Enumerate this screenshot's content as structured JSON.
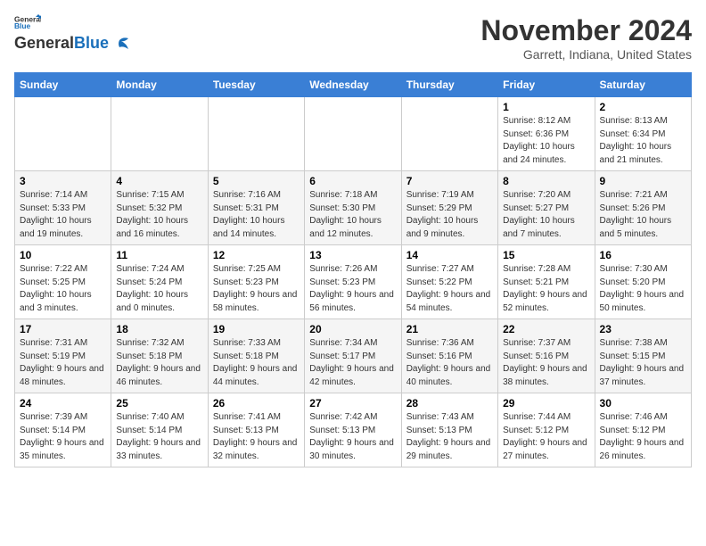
{
  "logo": {
    "general": "General",
    "blue": "Blue"
  },
  "header": {
    "title": "November 2024",
    "subtitle": "Garrett, Indiana, United States"
  },
  "weekdays": [
    "Sunday",
    "Monday",
    "Tuesday",
    "Wednesday",
    "Thursday",
    "Friday",
    "Saturday"
  ],
  "weeks": [
    [
      {
        "day": "",
        "info": ""
      },
      {
        "day": "",
        "info": ""
      },
      {
        "day": "",
        "info": ""
      },
      {
        "day": "",
        "info": ""
      },
      {
        "day": "",
        "info": ""
      },
      {
        "day": "1",
        "info": "Sunrise: 8:12 AM\nSunset: 6:36 PM\nDaylight: 10 hours and 24 minutes."
      },
      {
        "day": "2",
        "info": "Sunrise: 8:13 AM\nSunset: 6:34 PM\nDaylight: 10 hours and 21 minutes."
      }
    ],
    [
      {
        "day": "3",
        "info": "Sunrise: 7:14 AM\nSunset: 5:33 PM\nDaylight: 10 hours and 19 minutes."
      },
      {
        "day": "4",
        "info": "Sunrise: 7:15 AM\nSunset: 5:32 PM\nDaylight: 10 hours and 16 minutes."
      },
      {
        "day": "5",
        "info": "Sunrise: 7:16 AM\nSunset: 5:31 PM\nDaylight: 10 hours and 14 minutes."
      },
      {
        "day": "6",
        "info": "Sunrise: 7:18 AM\nSunset: 5:30 PM\nDaylight: 10 hours and 12 minutes."
      },
      {
        "day": "7",
        "info": "Sunrise: 7:19 AM\nSunset: 5:29 PM\nDaylight: 10 hours and 9 minutes."
      },
      {
        "day": "8",
        "info": "Sunrise: 7:20 AM\nSunset: 5:27 PM\nDaylight: 10 hours and 7 minutes."
      },
      {
        "day": "9",
        "info": "Sunrise: 7:21 AM\nSunset: 5:26 PM\nDaylight: 10 hours and 5 minutes."
      }
    ],
    [
      {
        "day": "10",
        "info": "Sunrise: 7:22 AM\nSunset: 5:25 PM\nDaylight: 10 hours and 3 minutes."
      },
      {
        "day": "11",
        "info": "Sunrise: 7:24 AM\nSunset: 5:24 PM\nDaylight: 10 hours and 0 minutes."
      },
      {
        "day": "12",
        "info": "Sunrise: 7:25 AM\nSunset: 5:23 PM\nDaylight: 9 hours and 58 minutes."
      },
      {
        "day": "13",
        "info": "Sunrise: 7:26 AM\nSunset: 5:23 PM\nDaylight: 9 hours and 56 minutes."
      },
      {
        "day": "14",
        "info": "Sunrise: 7:27 AM\nSunset: 5:22 PM\nDaylight: 9 hours and 54 minutes."
      },
      {
        "day": "15",
        "info": "Sunrise: 7:28 AM\nSunset: 5:21 PM\nDaylight: 9 hours and 52 minutes."
      },
      {
        "day": "16",
        "info": "Sunrise: 7:30 AM\nSunset: 5:20 PM\nDaylight: 9 hours and 50 minutes."
      }
    ],
    [
      {
        "day": "17",
        "info": "Sunrise: 7:31 AM\nSunset: 5:19 PM\nDaylight: 9 hours and 48 minutes."
      },
      {
        "day": "18",
        "info": "Sunrise: 7:32 AM\nSunset: 5:18 PM\nDaylight: 9 hours and 46 minutes."
      },
      {
        "day": "19",
        "info": "Sunrise: 7:33 AM\nSunset: 5:18 PM\nDaylight: 9 hours and 44 minutes."
      },
      {
        "day": "20",
        "info": "Sunrise: 7:34 AM\nSunset: 5:17 PM\nDaylight: 9 hours and 42 minutes."
      },
      {
        "day": "21",
        "info": "Sunrise: 7:36 AM\nSunset: 5:16 PM\nDaylight: 9 hours and 40 minutes."
      },
      {
        "day": "22",
        "info": "Sunrise: 7:37 AM\nSunset: 5:16 PM\nDaylight: 9 hours and 38 minutes."
      },
      {
        "day": "23",
        "info": "Sunrise: 7:38 AM\nSunset: 5:15 PM\nDaylight: 9 hours and 37 minutes."
      }
    ],
    [
      {
        "day": "24",
        "info": "Sunrise: 7:39 AM\nSunset: 5:14 PM\nDaylight: 9 hours and 35 minutes."
      },
      {
        "day": "25",
        "info": "Sunrise: 7:40 AM\nSunset: 5:14 PM\nDaylight: 9 hours and 33 minutes."
      },
      {
        "day": "26",
        "info": "Sunrise: 7:41 AM\nSunset: 5:13 PM\nDaylight: 9 hours and 32 minutes."
      },
      {
        "day": "27",
        "info": "Sunrise: 7:42 AM\nSunset: 5:13 PM\nDaylight: 9 hours and 30 minutes."
      },
      {
        "day": "28",
        "info": "Sunrise: 7:43 AM\nSunset: 5:13 PM\nDaylight: 9 hours and 29 minutes."
      },
      {
        "day": "29",
        "info": "Sunrise: 7:44 AM\nSunset: 5:12 PM\nDaylight: 9 hours and 27 minutes."
      },
      {
        "day": "30",
        "info": "Sunrise: 7:46 AM\nSunset: 5:12 PM\nDaylight: 9 hours and 26 minutes."
      }
    ]
  ]
}
